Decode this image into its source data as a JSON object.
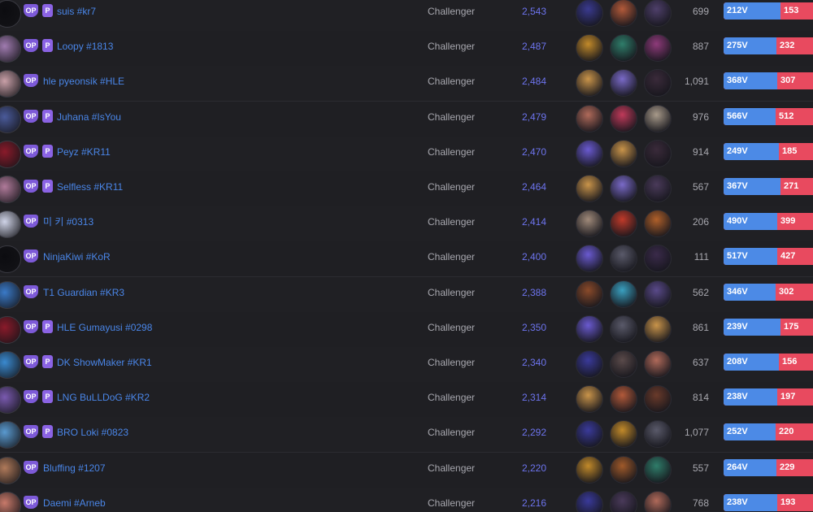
{
  "rows": [
    {
      "name": "suis #kr7",
      "p": true,
      "tier": "Challenger",
      "lp": "2,543",
      "level": "699",
      "wins": "212V",
      "losses": "153",
      "win_rate": 0.58,
      "avatar_color": "#0c0c10",
      "champs": [
        "#3a3a8f",
        "#b35a3a",
        "#4e3f6a"
      ]
    },
    {
      "name": "Loopy #1813",
      "p": true,
      "tier": "Challenger",
      "lp": "2,487",
      "level": "887",
      "wins": "275V",
      "losses": "232",
      "win_rate": 0.54,
      "avatar_color": "#a07bb0",
      "champs": [
        "#c28a2a",
        "#2f7d6a",
        "#8e3a7a"
      ]
    },
    {
      "name": "hle pyeonsik #HLE",
      "p": false,
      "tier": "Challenger",
      "lp": "2,484",
      "level": "1,091",
      "wins": "368V",
      "losses": "307",
      "win_rate": 0.55,
      "avatar_color": "#c9a0a8",
      "champs": [
        "#c9944a",
        "#7a6ac8",
        "#3a2a3a"
      ]
    },
    {
      "name": "Juhana #IsYou",
      "p": true,
      "tier": "Challenger",
      "lp": "2,479",
      "level": "976",
      "wins": "566V",
      "losses": "512",
      "win_rate": 0.53,
      "avatar_color": "#4a5a9a",
      "champs": [
        "#b06a5a",
        "#c03a5a",
        "#a89a8a"
      ]
    },
    {
      "name": "Peyz #KR11",
      "p": true,
      "tier": "Challenger",
      "lp": "2,470",
      "level": "914",
      "wins": "249V",
      "losses": "185",
      "win_rate": 0.57,
      "avatar_color": "#8a1a2a",
      "champs": [
        "#6a5ad0",
        "#c9944a",
        "#3a2a3a"
      ]
    },
    {
      "name": "Selfless #KR11",
      "p": true,
      "tier": "Challenger",
      "lp": "2,464",
      "level": "567",
      "wins": "367V",
      "losses": "271",
      "win_rate": 0.58,
      "avatar_color": "#b07a9a",
      "champs": [
        "#c9944a",
        "#7a6ac8",
        "#4a3a5a"
      ]
    },
    {
      "name": "미 키 #0313",
      "p": false,
      "tier": "Challenger",
      "lp": "2,414",
      "level": "206",
      "wins": "490V",
      "losses": "399",
      "win_rate": 0.55,
      "avatar_color": "#d0d4e8",
      "champs": [
        "#a08a7a",
        "#c03a2a",
        "#b0602a"
      ]
    },
    {
      "name": "NinjaKiwi #KoR",
      "p": false,
      "tier": "Challenger",
      "lp": "2,400",
      "level": "111",
      "wins": "517V",
      "losses": "427",
      "win_rate": 0.55,
      "avatar_color": "#0c0c10",
      "champs": [
        "#6a5ad0",
        "#5a5a6a",
        "#3a2a4a"
      ]
    },
    {
      "name": "T1 Guardian #KR3",
      "p": false,
      "tier": "Challenger",
      "lp": "2,388",
      "level": "562",
      "wins": "346V",
      "losses": "302",
      "win_rate": 0.53,
      "avatar_color": "#3a7ac8",
      "champs": [
        "#8a4a2a",
        "#3aa0c0",
        "#5a4a8a"
      ]
    },
    {
      "name": "HLE Gumayusi #0298",
      "p": true,
      "tier": "Challenger",
      "lp": "2,350",
      "level": "861",
      "wins": "239V",
      "losses": "175",
      "win_rate": 0.58,
      "avatar_color": "#8a1a2a",
      "champs": [
        "#6a5ad0",
        "#5a5a6a",
        "#c9944a"
      ]
    },
    {
      "name": "DK ShowMaker #KR1",
      "p": true,
      "tier": "Challenger",
      "lp": "2,340",
      "level": "637",
      "wins": "208V",
      "losses": "156",
      "win_rate": 0.57,
      "avatar_color": "#3a8ad0",
      "champs": [
        "#3a3a9a",
        "#5a4a4a",
        "#b06a5a"
      ]
    },
    {
      "name": "LNG BuLLDoG #KR2",
      "p": true,
      "tier": "Challenger",
      "lp": "2,314",
      "level": "814",
      "wins": "238V",
      "losses": "197",
      "win_rate": 0.55,
      "avatar_color": "#7a5ab0",
      "champs": [
        "#c9944a",
        "#b35a3a",
        "#6a3a2a"
      ]
    },
    {
      "name": "BRO Loki #0823",
      "p": true,
      "tier": "Challenger",
      "lp": "2,292",
      "level": "1,077",
      "wins": "252V",
      "losses": "220",
      "win_rate": 0.53,
      "avatar_color": "#5a9ad0",
      "champs": [
        "#3a3a9a",
        "#c28a2a",
        "#5a5a6a"
      ]
    },
    {
      "name": "Bluffing #1207",
      "p": false,
      "tier": "Challenger",
      "lp": "2,220",
      "level": "557",
      "wins": "264V",
      "losses": "229",
      "win_rate": 0.54,
      "avatar_color": "#b07a5a",
      "champs": [
        "#c28a2a",
        "#a05a2a",
        "#2f7d6a"
      ]
    },
    {
      "name": "Daemi #Arneb",
      "p": false,
      "tier": "Challenger",
      "lp": "2,216",
      "level": "768",
      "wins": "238V",
      "losses": "193",
      "win_rate": 0.55,
      "avatar_color": "#c97a6a",
      "champs": [
        "#3a3a9a",
        "#4a3a5a",
        "#b06a5a"
      ]
    }
  ],
  "op_label": "OP",
  "p_label": "P"
}
